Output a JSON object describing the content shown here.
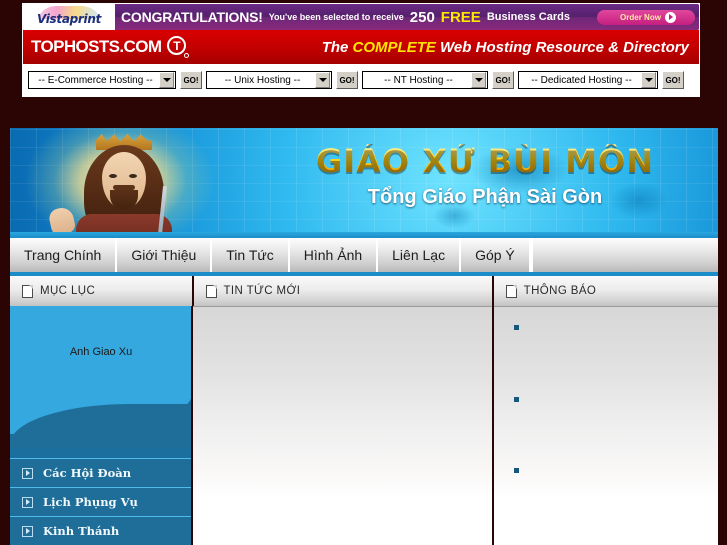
{
  "ad": {
    "brand": "Vistaprint",
    "congrats": "CONGRATULATIONS!",
    "line": "You've been selected to receive",
    "quantity": "250",
    "free": "FREE",
    "product": "Business Cards",
    "cta": "Order Now"
  },
  "hosting_bar": {
    "logo_text": "TOPHOSTS.COM",
    "logo_mark": "T",
    "tagline_pre": "The",
    "tagline_hl": "COMPLETE",
    "tagline_post": "Web Hosting Resource & Directory",
    "selects": [
      {
        "value": "-- E-Commerce Hosting --",
        "go": "GO!"
      },
      {
        "value": "-- Unix Hosting --",
        "go": "GO!"
      },
      {
        "value": "-- NT Hosting --",
        "go": "GO!"
      },
      {
        "value": "-- Dedicated Hosting --",
        "go": "GO!"
      }
    ]
  },
  "banner": {
    "title": "GIÁO XỨ BÙI MÔN",
    "subtitle": "Tổng Giáo Phận Sài Gòn"
  },
  "nav": {
    "items": [
      {
        "label": "Trang Chính"
      },
      {
        "label": "Giới Thiệu"
      },
      {
        "label": "Tin Tức"
      },
      {
        "label": "Hình Ảnh"
      },
      {
        "label": "Liên Lạc"
      },
      {
        "label": "Góp Ý"
      }
    ]
  },
  "columns": {
    "left_header": "MỤC LỤC",
    "mid_header": "TIN TỨC MỚI",
    "right_header": "THÔNG BÁO"
  },
  "sidebar": {
    "image_alt": "Anh Giao Xu",
    "items": [
      {
        "label": "Các Hội Đoàn"
      },
      {
        "label": "Lịch Phụng Vụ"
      },
      {
        "label": "Kinh Thánh"
      }
    ]
  },
  "colors": {
    "page_background": "#2b0404",
    "accent_red": "#c10000",
    "accent_blue": "#1b8cc8",
    "sidebar_blue": "#1f6e99",
    "sky_blue": "#35a8e0",
    "gold": "#ffd21a",
    "bullet": "#14587e"
  }
}
